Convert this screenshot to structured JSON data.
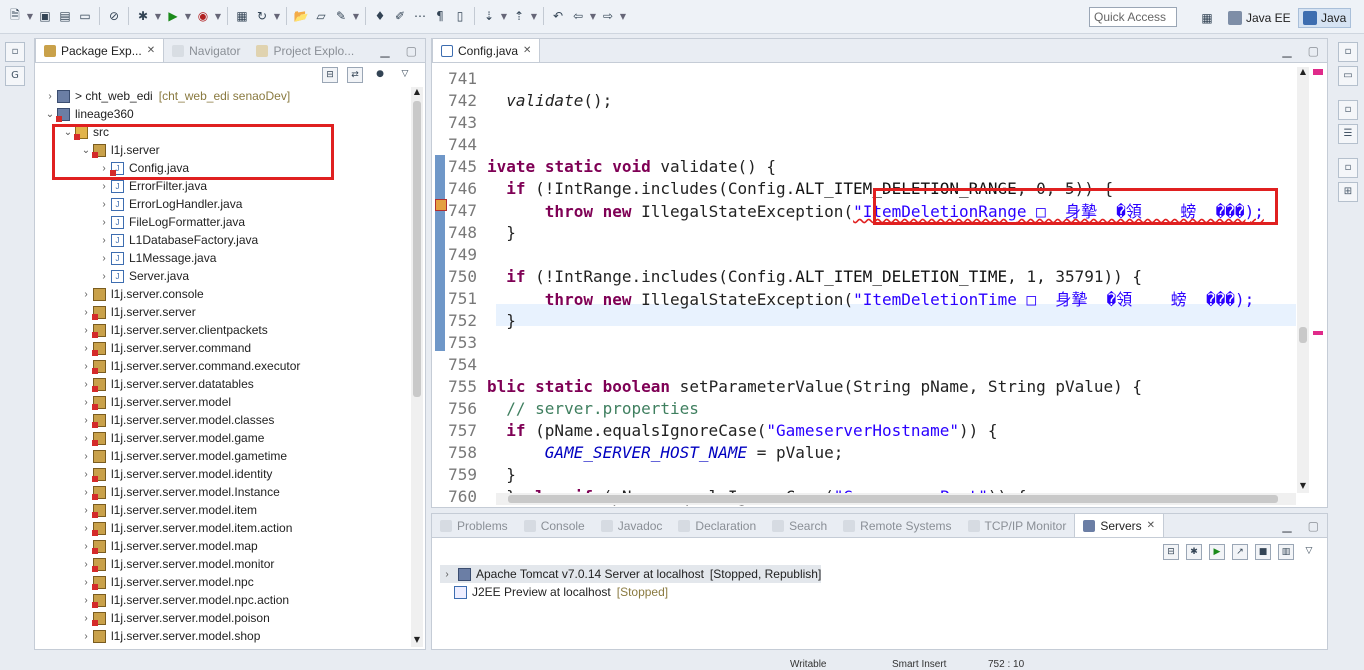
{
  "toolbar": {
    "quick_access_placeholder": "Quick Access",
    "perspectives": [
      "Java EE",
      "Java"
    ]
  },
  "package_explorer": {
    "tabs": [
      {
        "label": "Package Exp...",
        "active": true
      },
      {
        "label": "Navigator",
        "active": false
      },
      {
        "label": "Project Explo...",
        "active": false
      }
    ],
    "projects": [
      {
        "label": "> cht_web_edi",
        "decoration": "[cht_web_edi senaoDev]"
      },
      {
        "label": "lineage360"
      }
    ],
    "src": "src",
    "package_open": "l1j.server",
    "files": [
      "Config.java",
      "ErrorFilter.java",
      "ErrorLogHandler.java",
      "FileLogFormatter.java",
      "L1DatabaseFactory.java",
      "L1Message.java",
      "Server.java"
    ],
    "packages": [
      "l1j.server.console",
      "l1j.server.server",
      "l1j.server.server.clientpackets",
      "l1j.server.server.command",
      "l1j.server.server.command.executor",
      "l1j.server.server.datatables",
      "l1j.server.server.model",
      "l1j.server.server.model.classes",
      "l1j.server.server.model.game",
      "l1j.server.server.model.gametime",
      "l1j.server.server.model.identity",
      "l1j.server.server.model.Instance",
      "l1j.server.server.model.item",
      "l1j.server.server.model.item.action",
      "l1j.server.server.model.map",
      "l1j.server.server.model.monitor",
      "l1j.server.server.model.npc",
      "l1j.server.server.model.npc.action",
      "l1j.server.server.model.poison",
      "l1j.server.server.model.shop"
    ]
  },
  "editor": {
    "tab": "Config.java",
    "lines": [
      {
        "n": "741",
        "t": ""
      },
      {
        "n": "742",
        "t": "  validate();"
      },
      {
        "n": "743",
        "t": ""
      },
      {
        "n": "744",
        "t": ""
      },
      {
        "n": "745",
        "t": "ivate static void validate() {"
      },
      {
        "n": "746",
        "t": "  if (!IntRange.includes(Config.ALT_ITEM_DELETION_RANGE, 0, 5)) {"
      },
      {
        "n": "747",
        "t": "      throw new IllegalStateException(\"ItemDeletionRange □  身摯  �領    螃  ���);"
      },
      {
        "n": "748",
        "t": "  }"
      },
      {
        "n": "749",
        "t": ""
      },
      {
        "n": "750",
        "t": "  if (!IntRange.includes(Config.ALT_ITEM_DELETION_TIME, 1, 35791)) {"
      },
      {
        "n": "751",
        "t": "      throw new IllegalStateException(\"ItemDeletionTime □  身摯  �領    螃  ���);"
      },
      {
        "n": "752",
        "t": "  }"
      },
      {
        "n": "753",
        "t": ""
      },
      {
        "n": "754",
        "t": ""
      },
      {
        "n": "755",
        "t": "blic static boolean setParameterValue(String pName, String pValue) {"
      },
      {
        "n": "756",
        "t": "  // server.properties"
      },
      {
        "n": "757",
        "t": "  if (pName.equalsIgnoreCase(\"GameserverHostname\")) {"
      },
      {
        "n": "758",
        "t": "      GAME_SERVER_HOST_NAME = pValue;"
      },
      {
        "n": "759",
        "t": "  }"
      },
      {
        "n": "760",
        "t": "  } else if (pName.equalsIgnoreCase(\"GameserverPort\")) {"
      }
    ]
  },
  "bottom": {
    "tabs": [
      "Problems",
      "Console",
      "Javadoc",
      "Declaration",
      "Search",
      "Remote Systems",
      "TCP/IP Monitor",
      "Servers"
    ],
    "active_tab": "Servers",
    "servers": [
      {
        "name": "Apache Tomcat v7.0.14 Server at localhost",
        "state": "[Stopped, Republish]"
      },
      {
        "name": "J2EE Preview at localhost",
        "state": "[Stopped]"
      }
    ]
  },
  "status_bar": {
    "writable": "Writable",
    "insert": "Smart Insert",
    "position": "752 : 10"
  },
  "colors": {
    "keyword": "#7f0055",
    "string": "#2a00ff",
    "comment": "#3f7f5f",
    "highlight_box": "#e02020"
  }
}
